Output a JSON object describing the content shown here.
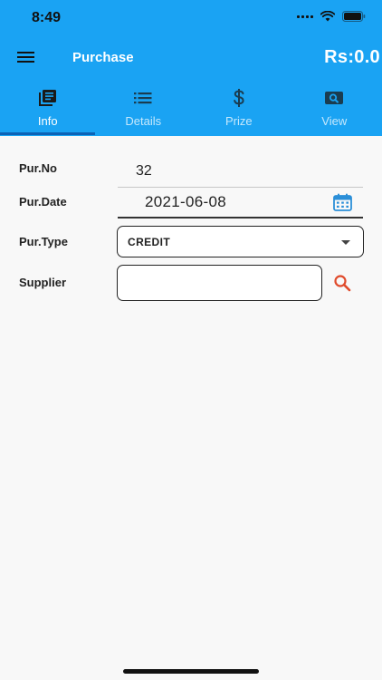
{
  "status_bar": {
    "time": "8:49"
  },
  "app_bar": {
    "title": "Purchase",
    "amount": "Rs:0.0"
  },
  "tabs": [
    {
      "label": "Info",
      "icon": "library-books-icon",
      "active": true
    },
    {
      "label": "Details",
      "icon": "list-icon",
      "active": false
    },
    {
      "label": "Prize",
      "icon": "dollar-icon",
      "active": false
    },
    {
      "label": "View",
      "icon": "image-search-icon",
      "active": false
    }
  ],
  "form": {
    "pur_no_label": "Pur.No",
    "pur_no_value": "32",
    "pur_date_label": "Pur.Date",
    "pur_date_value": "2021-06-08",
    "pur_type_label": "Pur.Type",
    "pur_type_value": "CREDIT",
    "supplier_label": "Supplier",
    "supplier_value": ""
  },
  "colors": {
    "primary": "#1aa3f3",
    "tab_indicator": "#0d62b5",
    "calendar_icon": "#2b8fd8",
    "search_icon": "#e04b2c"
  }
}
